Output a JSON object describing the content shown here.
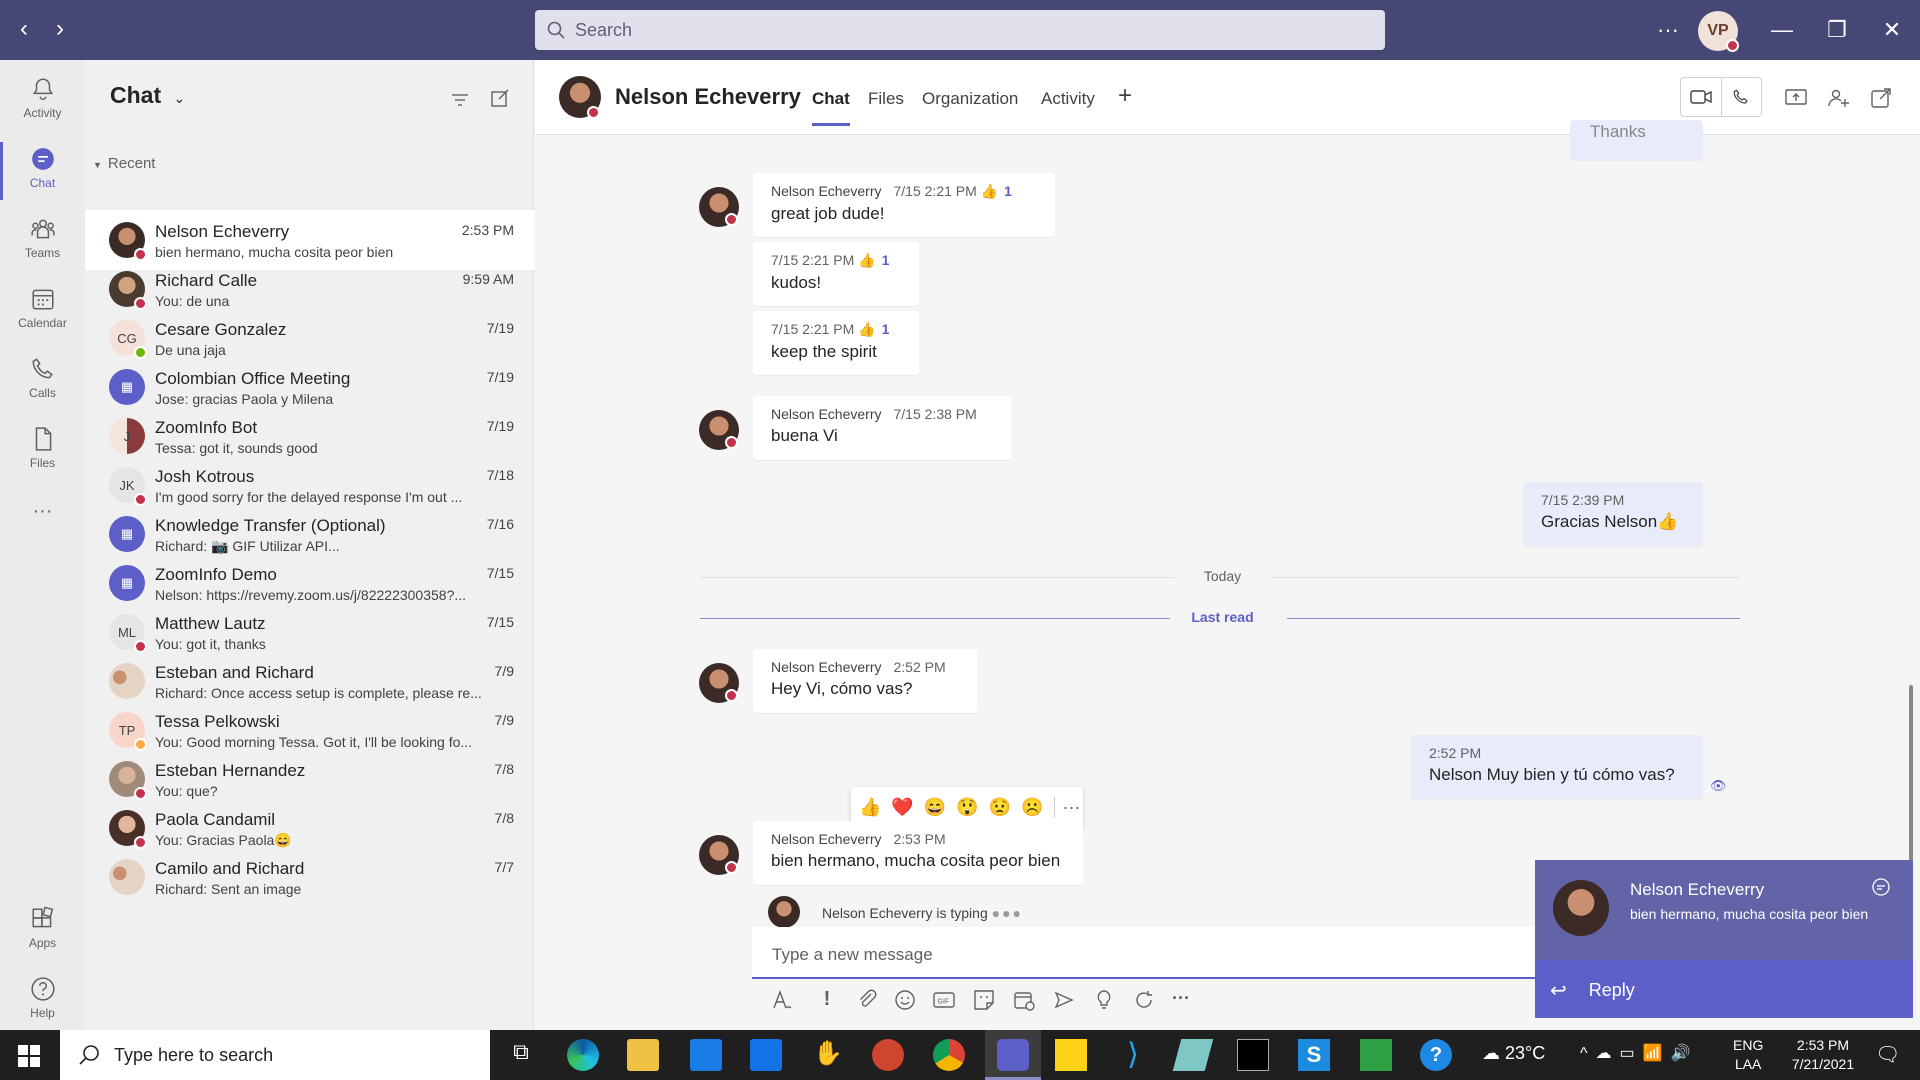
{
  "search": {
    "placeholder": "Search"
  },
  "user": {
    "initials": "VP"
  },
  "rail": [
    {
      "label": "Activity",
      "icon": "bell-icon"
    },
    {
      "label": "Chat",
      "icon": "chat-icon"
    },
    {
      "label": "Teams",
      "icon": "teams-icon"
    },
    {
      "label": "Calendar",
      "icon": "calendar-icon"
    },
    {
      "label": "Calls",
      "icon": "phone-icon"
    },
    {
      "label": "Files",
      "icon": "file-icon"
    },
    {
      "label": "Apps",
      "icon": "apps-icon"
    },
    {
      "label": "Help",
      "icon": "help-icon"
    }
  ],
  "chatlist": {
    "title": "Chat",
    "section": "Recent",
    "items": [
      {
        "name": "Nelson Echeverry",
        "preview": "bien hermano, mucha cosita peor bien",
        "time": "2:53 PM",
        "initials": ""
      },
      {
        "name": "Richard Calle",
        "preview": "You: de una",
        "time": "9:59 AM",
        "initials": ""
      },
      {
        "name": "Cesare Gonzalez",
        "preview": "De una jaja",
        "time": "7/19",
        "initials": "CG"
      },
      {
        "name": "Colombian Office Meeting",
        "preview": "Jose: gracias Paola y Milena",
        "time": "7/19",
        "initials": ""
      },
      {
        "name": "ZoomInfo Bot",
        "preview": "Tessa: got it, sounds good",
        "time": "7/19",
        "initials": "J"
      },
      {
        "name": "Josh Kotrous",
        "preview": "I'm good sorry for the delayed response I'm out ...",
        "time": "7/18",
        "initials": "JK"
      },
      {
        "name": "Knowledge Transfer (Optional)",
        "preview": "Richard: 📷 GIF Utilizar API...",
        "time": "7/16",
        "initials": ""
      },
      {
        "name": "ZoomInfo Demo",
        "preview": "Nelson: https://revemy.zoom.us/j/82222300358?...",
        "time": "7/15",
        "initials": ""
      },
      {
        "name": "Matthew Lautz",
        "preview": "You: got it, thanks",
        "time": "7/15",
        "initials": "ML"
      },
      {
        "name": "Esteban and Richard",
        "preview": "Richard: Once access setup is complete, please re...",
        "time": "7/9",
        "initials": ""
      },
      {
        "name": "Tessa Pelkowski",
        "preview": "You: Good morning Tessa. Got it, I'll be looking fo...",
        "time": "7/9",
        "initials": "TP"
      },
      {
        "name": "Esteban Hernandez",
        "preview": "You: que?",
        "time": "7/8",
        "initials": ""
      },
      {
        "name": "Paola Candamil",
        "preview": "You: Gracias Paola😄",
        "time": "7/8",
        "initials": ""
      },
      {
        "name": "Camilo and Richard",
        "preview": "Richard: Sent an image",
        "time": "7/7",
        "initials": ""
      }
    ]
  },
  "conversation": {
    "contact": "Nelson Echeverry",
    "tabs": [
      "Chat",
      "Files",
      "Organization",
      "Activity"
    ],
    "messages": [
      {
        "author": "Nelson Echeverry",
        "time": "7/15 2:21 PM",
        "text": "great job dude!",
        "reaction": "1"
      },
      {
        "author": "",
        "time": "7/15 2:21 PM",
        "text": "kudos!",
        "reaction": "1"
      },
      {
        "author": "",
        "time": "7/15 2:21 PM",
        "text": "keep the spirit",
        "reaction": "1"
      },
      {
        "author": "Nelson Echeverry",
        "time": "7/15 2:38 PM",
        "text": "buena Vi",
        "reaction": ""
      },
      {
        "author": "",
        "time": "7/15 2:39 PM",
        "text": "Gracias Nelson👍",
        "reaction": ""
      },
      {
        "author": "Nelson Echeverry",
        "time": "2:52 PM",
        "text": "Hey Vi, cómo vas?",
        "reaction": ""
      },
      {
        "author": "",
        "time": "2:52 PM",
        "text": "Nelson Muy bien y tú cómo vas?",
        "reaction": ""
      },
      {
        "author": "Nelson Echeverry",
        "time": "2:53 PM",
        "text": "bien hermano, mucha cosita peor bien",
        "reaction": ""
      }
    ],
    "today_label": "Today",
    "last_read_label": "Last read",
    "typing": "Nelson Echeverry is typing",
    "compose_placeholder": "Type a new message",
    "partial_top": "Thanks"
  },
  "toast": {
    "name": "Nelson Echeverry",
    "message": "bien hermano, mucha cosita peor bien",
    "reply": "Reply"
  },
  "taskbar": {
    "search": "Type here to search",
    "weather": "23°C",
    "lang1": "ENG",
    "lang2": "LAA",
    "time": "2:53 PM",
    "date": "7/21/2021"
  },
  "colors": {
    "brand": "#464775",
    "accent": "#5b5fc7",
    "presence_busy": "#c4314b"
  }
}
